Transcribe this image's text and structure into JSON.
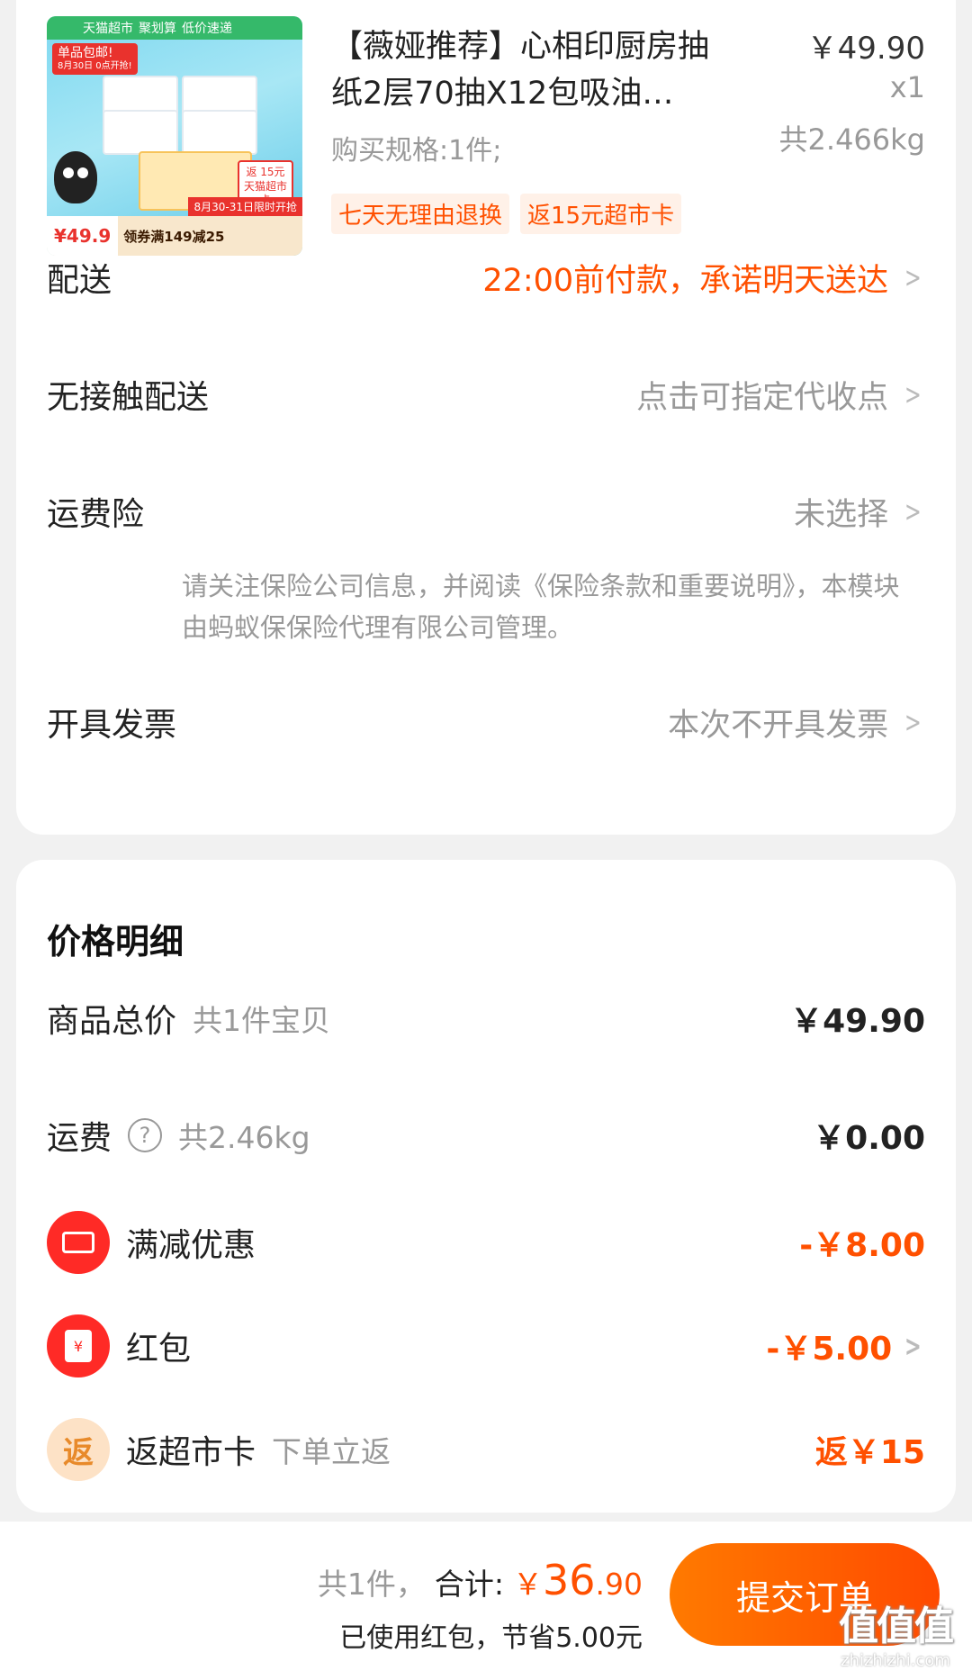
{
  "product": {
    "title": "【薇娅推荐】心相印厨房抽纸2层70抽X12包吸油…",
    "price": "￥49.90",
    "qty": "x1",
    "weight": "共2.466kg",
    "spec": "购买规格:1件;",
    "tags": [
      "七天无理由退换",
      "返15元超市卡"
    ],
    "thumb": {
      "badge_top": [
        "天猫超市",
        "聚划算",
        "低价速递"
      ],
      "tag_red": "单品包邮!",
      "tag_red_sub": "8月30日 0点开抢!",
      "rebate": "返 15元 天猫超市卡",
      "strip": "8月30-31日限时开抢",
      "price": "¥49.9",
      "coupon": "领券满149减25"
    }
  },
  "delivery": {
    "label": "配送",
    "value": "22:00前付款，承诺明天送达"
  },
  "contactless": {
    "label": "无接触配送",
    "value": "点击可指定代收点"
  },
  "insurance": {
    "label": "运费险",
    "value": "未选择",
    "note": "请关注保险公司信息，并阅读《保险条款和重要说明》，本模块由蚂蚁保保险代理有限公司管理。"
  },
  "invoice": {
    "label": "开具发票",
    "value": "本次不开具发票"
  },
  "price_detail": {
    "title": "价格明细",
    "goods": {
      "label": "商品总价",
      "sub": "共1件宝贝",
      "amount": "￥49.90"
    },
    "shipping": {
      "label": "运费",
      "sub": "共2.46kg",
      "amount": "￥0.00"
    },
    "discount": {
      "label": "满减优惠",
      "amount": "-￥8.00"
    },
    "red_packet": {
      "label": "红包",
      "amount": "-￥5.00",
      "icon_text": "¥"
    },
    "cashback": {
      "icon_text": "返",
      "label": "返超市卡",
      "sub": "下单立返",
      "amount": "返￥15"
    }
  },
  "bottom_bar": {
    "count": "共1件，",
    "sum_label": "合计:",
    "currency": "￥",
    "total_int": "36",
    "total_dec": ".90",
    "saved": "已使用红包，节省5.00元",
    "submit": "提交订单"
  },
  "watermark": {
    "main": "值值值",
    "sub": "zhizhizhi.com"
  },
  "colors": {
    "accent": "#ff5000",
    "red_icon": "#ff2a26",
    "muted": "#999999"
  }
}
